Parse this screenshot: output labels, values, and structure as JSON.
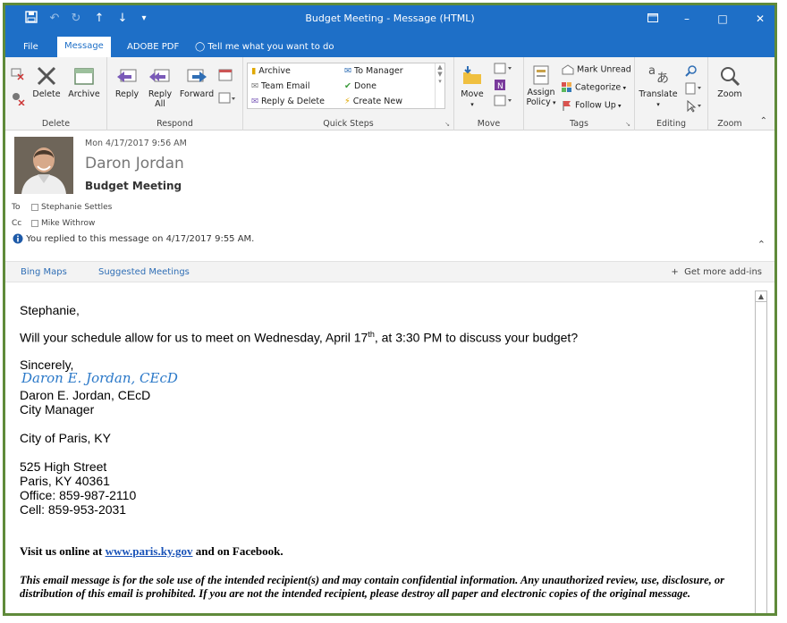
{
  "window": {
    "title": "Budget Meeting  -  Message (HTML)"
  },
  "tabs": [
    {
      "label": "File"
    },
    {
      "label": "Message"
    },
    {
      "label": "ADOBE PDF"
    },
    {
      "label": "Tell me what you want to do"
    }
  ],
  "ribbon": {
    "delete_group": {
      "label": "Delete",
      "delete": "Delete",
      "archive": "Archive"
    },
    "respond_group": {
      "label": "Respond",
      "reply": "Reply",
      "reply_all_1": "Reply",
      "reply_all_2": "All",
      "forward": "Forward"
    },
    "quick_steps": {
      "label": "Quick Steps",
      "items": [
        "Archive",
        "To Manager",
        "Team Email",
        "Done",
        "Reply & Delete",
        "Create New"
      ]
    },
    "move_group": {
      "label": "Move",
      "move": "Move"
    },
    "tags_group": {
      "label": "Tags",
      "assign_1": "Assign",
      "assign_2": "Policy",
      "mark_unread": "Mark Unread",
      "categorize": "Categorize",
      "follow_up": "Follow Up"
    },
    "editing_group": {
      "label": "Editing",
      "translate": "Translate"
    },
    "zoom_group": {
      "label": "Zoom",
      "zoom": "Zoom"
    }
  },
  "message": {
    "date": "Mon 4/17/2017 9:56 AM",
    "sender": "Daron Jordan",
    "subject": "Budget Meeting",
    "to_label": "To",
    "to": "Stephanie Settles",
    "cc_label": "Cc",
    "cc": "Mike Withrow",
    "replied_notice": "You replied to this message on 4/17/2017 9:55 AM."
  },
  "addins": {
    "bing_maps": "Bing Maps",
    "suggested_meetings": "Suggested Meetings",
    "get_more": "Get more add-ins"
  },
  "body": {
    "greeting": "Stephanie,",
    "line1_a": "Will your schedule allow for us to meet on Wednesday, April 17",
    "line1_sup": "th",
    "line1_b": ", at 3:30 PM to discuss your budget?",
    "closing": "Sincerely,",
    "signature_script": "Daron E. Jordan, CEcD",
    "signature_name": "Daron E. Jordan, CEcD",
    "signature_title": "City Manager",
    "org": "City of Paris, KY",
    "address1": "525 High Street",
    "address2": "Paris, KY 40361",
    "office": "Office: 859-987-2110",
    "cell": "Cell: 859-953-2031",
    "visit_a": "Visit us online at ",
    "visit_link": "www.paris.ky.gov",
    "visit_b": " and on Facebook.",
    "disclaimer": "This email message is for the sole use of the intended recipient(s) and may contain confidential information. Any unauthorized review, use, disclosure, or distribution of this email is prohibited. If you are not the intended recipient, please destroy all paper and electronic copies of the original message."
  },
  "colors": {
    "brand": "#1e6fc7",
    "link": "#2f6eb5",
    "frame": "#5f8a3a"
  }
}
